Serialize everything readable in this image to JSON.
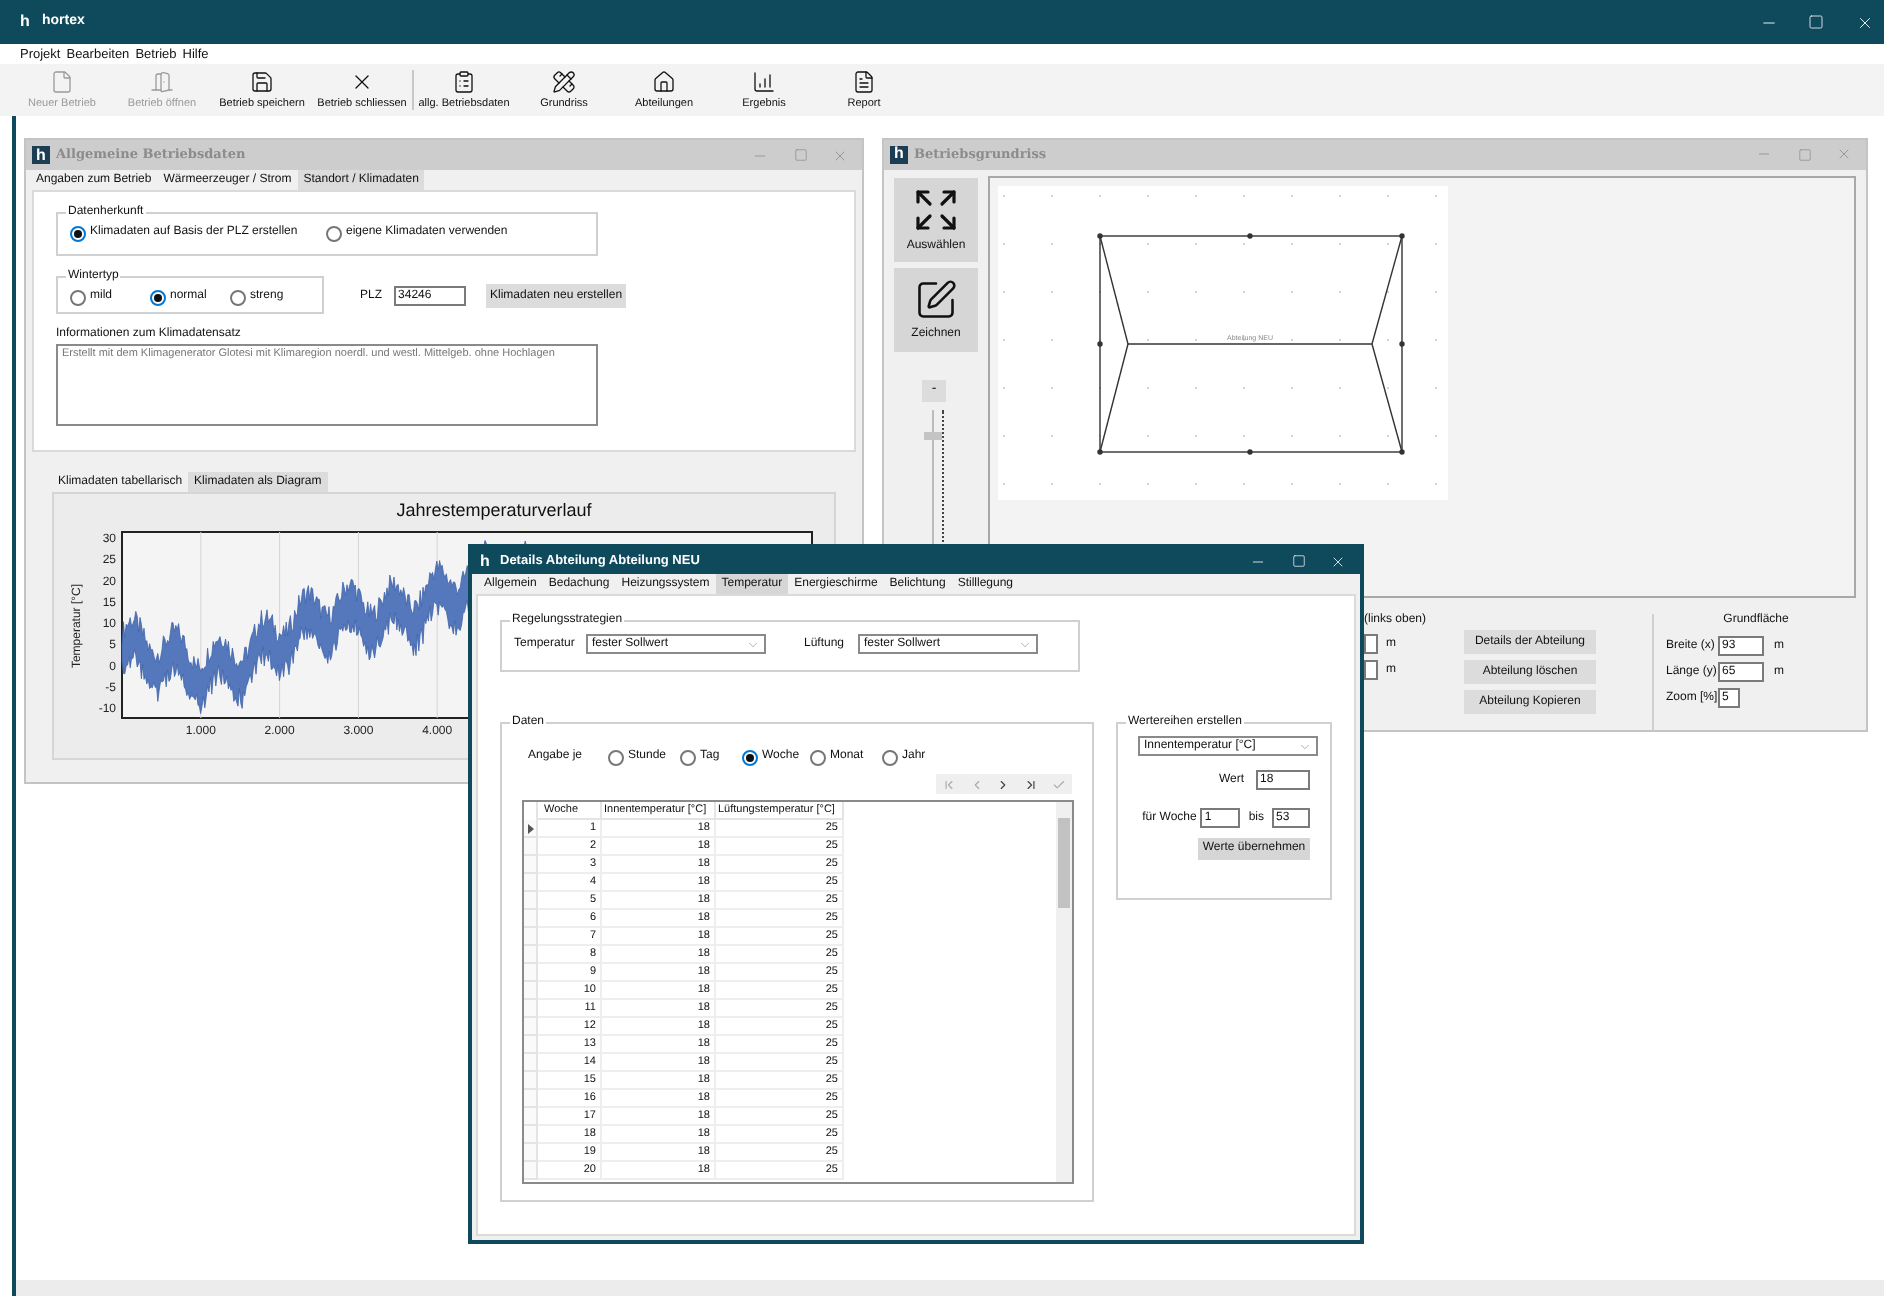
{
  "app": {
    "logo": "h",
    "title": "hortex",
    "menu": [
      "Projekt",
      "Bearbeiten",
      "Betrieb",
      "Hilfe"
    ],
    "toolbar": [
      {
        "label": "Neuer Betrieb",
        "disabled": true
      },
      {
        "label": "Betrieb öffnen",
        "disabled": true
      },
      {
        "label": "Betrieb speichern",
        "disabled": false
      },
      {
        "label": "Betrieb schliessen",
        "disabled": false
      },
      {
        "label": "allg. Betriebsdaten",
        "disabled": false
      },
      {
        "label": "Grundriss",
        "disabled": false
      },
      {
        "label": "Abteilungen",
        "disabled": false
      },
      {
        "label": "Ergebnis",
        "disabled": false
      },
      {
        "label": "Report",
        "disabled": false
      }
    ]
  },
  "betriebsdaten_window": {
    "logo": "h",
    "title": "Allgemeine Betriebsdaten",
    "tabs": [
      {
        "label": "Angaben zum Betrieb",
        "selected": false
      },
      {
        "label": "Wärmeerzeuger / Strom",
        "selected": false
      },
      {
        "label": "Standort / Klimadaten",
        "selected": true
      }
    ],
    "datenherkunft": {
      "legend": "Datenherkunft",
      "options": [
        {
          "label": "Klimadaten auf Basis der PLZ erstellen",
          "selected": true
        },
        {
          "label": "eigene Klimadaten verwenden",
          "selected": false
        }
      ]
    },
    "wintertyp": {
      "legend": "Wintertyp",
      "options": [
        {
          "label": "mild",
          "selected": false
        },
        {
          "label": "normal",
          "selected": true
        },
        {
          "label": "streng",
          "selected": false
        }
      ]
    },
    "plz": {
      "label": "PLZ",
      "value": "34246"
    },
    "create_button": "Klimadaten neu erstellen",
    "info": {
      "label": "Informationen zum Klimadatensatz",
      "value": "Erstellt mit dem Klimagenerator Glotesi mit Klimaregion noerdl. und westl. Mittelgeb. ohne Hochlagen"
    },
    "chart_tabs": [
      {
        "label": "Klimadaten tabellarisch",
        "selected": false
      },
      {
        "label": "Klimadaten als Diagram",
        "selected": true
      }
    ],
    "chart": {
      "title": "Jahrestemperaturverlauf",
      "ylabel": "Temperatur [°C]",
      "yticks": [
        "30",
        "25",
        "20",
        "15",
        "10",
        "5",
        "0",
        "-5",
        "-10"
      ],
      "xticks": [
        "1.000",
        "2.000",
        "3.000",
        "4.000"
      ]
    }
  },
  "grundriss_window": {
    "logo": "h",
    "title": "Betriebsgrundriss",
    "tools": [
      "Auswählen",
      "Zeichnen"
    ],
    "zoom_minus": "-",
    "zoom_slider": {
      "level": 0.86
    },
    "floor_plan_label": "Abteilung NEU",
    "position": {
      "label": "(links oben)",
      "units": [
        "m",
        "m"
      ]
    },
    "buttons": [
      "Details der Abteilung",
      "Abteilung löschen",
      "Abteilung Kopieren"
    ],
    "grundflaeche": {
      "title": "Grundfläche",
      "fields": [
        {
          "label": "Breite (x)",
          "value": "93",
          "unit": "m"
        },
        {
          "label": "Länge (y)",
          "value": "65",
          "unit": "m"
        },
        {
          "label": "Zoom [%]",
          "value": "5"
        }
      ]
    }
  },
  "details_dialog": {
    "logo": "h",
    "title": "Details Abteilung Abteilung NEU",
    "tabs": [
      {
        "label": "Allgemein",
        "selected": false
      },
      {
        "label": "Bedachung",
        "selected": false
      },
      {
        "label": "Heizungssystem",
        "selected": false
      },
      {
        "label": "Temperatur",
        "selected": true
      },
      {
        "label": "Energieschirme",
        "selected": false
      },
      {
        "label": "Belichtung",
        "selected": false
      },
      {
        "label": "Stilllegung",
        "selected": false
      }
    ],
    "regelungsstrategien": {
      "legend": "Regelungsstrategien",
      "fields": [
        {
          "label": "Temperatur",
          "value": "fester Sollwert"
        },
        {
          "label": "Lüftung",
          "value": "fester Sollwert"
        }
      ]
    },
    "daten": {
      "legend": "Daten",
      "angabe_label": "Angabe je",
      "options": [
        {
          "label": "Stunde",
          "selected": false
        },
        {
          "label": "Tag",
          "selected": false
        },
        {
          "label": "Woche",
          "selected": true
        },
        {
          "label": "Monat",
          "selected": false
        },
        {
          "label": "Jahr",
          "selected": false
        }
      ],
      "table": {
        "columns": [
          "Woche",
          "Innentemperatur [°C]",
          "Lüftungstemperatur [°C]"
        ],
        "rows": [
          {
            "cells": [
              "1",
              "18",
              "25"
            ],
            "current": true
          },
          {
            "cells": [
              "2",
              "18",
              "25"
            ],
            "current": false
          },
          {
            "cells": [
              "3",
              "18",
              "25"
            ],
            "current": false
          },
          {
            "cells": [
              "4",
              "18",
              "25"
            ],
            "current": false
          },
          {
            "cells": [
              "5",
              "18",
              "25"
            ],
            "current": false
          },
          {
            "cells": [
              "6",
              "18",
              "25"
            ],
            "current": false
          },
          {
            "cells": [
              "7",
              "18",
              "25"
            ],
            "current": false
          },
          {
            "cells": [
              "8",
              "18",
              "25"
            ],
            "current": false
          },
          {
            "cells": [
              "9",
              "18",
              "25"
            ],
            "current": false
          },
          {
            "cells": [
              "10",
              "18",
              "25"
            ],
            "current": false
          },
          {
            "cells": [
              "11",
              "18",
              "25"
            ],
            "current": false
          },
          {
            "cells": [
              "12",
              "18",
              "25"
            ],
            "current": false
          },
          {
            "cells": [
              "13",
              "18",
              "25"
            ],
            "current": false
          },
          {
            "cells": [
              "14",
              "18",
              "25"
            ],
            "current": false
          },
          {
            "cells": [
              "15",
              "18",
              "25"
            ],
            "current": false
          },
          {
            "cells": [
              "16",
              "18",
              "25"
            ],
            "current": false
          },
          {
            "cells": [
              "17",
              "18",
              "25"
            ],
            "current": false
          },
          {
            "cells": [
              "18",
              "18",
              "25"
            ],
            "current": false
          },
          {
            "cells": [
              "19",
              "18",
              "25"
            ],
            "current": false
          },
          {
            "cells": [
              "20",
              "18",
              "25"
            ],
            "current": false
          }
        ]
      }
    },
    "wertereihen": {
      "legend": "Wertereihen erstellen",
      "series": "Innentemperatur [°C]",
      "wert": {
        "label": "Wert",
        "value": "18"
      },
      "woche": {
        "label": "für Woche",
        "from": "1",
        "bis_label": "bis",
        "to": "53"
      },
      "button": "Werte übernehmen"
    }
  }
}
